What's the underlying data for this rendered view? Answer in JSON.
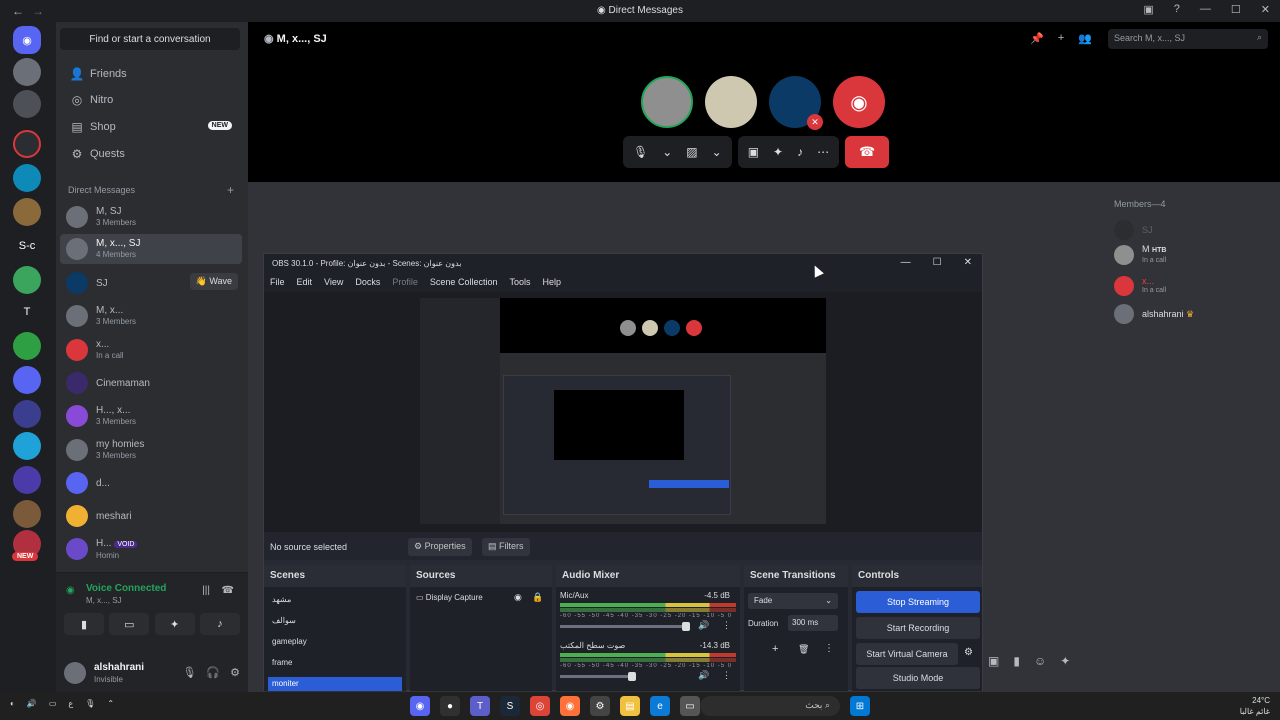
{
  "titlebar": {
    "title": "Direct Messages"
  },
  "sidebar": {
    "search_label": "Find or start a conversation",
    "nav": [
      {
        "label": "Friends",
        "icon": "friends-icon"
      },
      {
        "label": "Nitro",
        "icon": "nitro-icon"
      },
      {
        "label": "Shop",
        "icon": "shop-icon",
        "badge": "NEW"
      },
      {
        "label": "Quests",
        "icon": "quests-icon"
      }
    ],
    "dm_header": "Direct Messages",
    "dms": [
      {
        "name": "M, SJ",
        "sub": "3 Members"
      },
      {
        "name": "M, x..., SJ",
        "sub": "4 Members"
      },
      {
        "name": "SJ",
        "sub": "",
        "action": "Wave"
      },
      {
        "name": "M, x...",
        "sub": "3 Members"
      },
      {
        "name": "x...",
        "sub": "In a call"
      },
      {
        "name": "Cinemaman",
        "sub": ""
      },
      {
        "name": "H..., x...",
        "sub": "3 Members"
      },
      {
        "name": "my homies",
        "sub": "3 Members"
      },
      {
        "name": "d...",
        "sub": ""
      },
      {
        "name": "meshari",
        "sub": ""
      },
      {
        "name": "H...",
        "sub": "Homin",
        "tag": "VOID"
      }
    ],
    "voice": {
      "title": "Voice Connected",
      "sub": "M, x..., SJ"
    },
    "user": {
      "name": "alshahrani",
      "status": "Invisible"
    }
  },
  "rail": {
    "new_badge": "NEW",
    "text_servers": [
      "S-c",
      "T"
    ]
  },
  "call": {
    "header": "M, x..., SJ",
    "search_placeholder": "Search M, x..., SJ",
    "members_header": "Members—4",
    "members": [
      {
        "name": "SJ",
        "sub": ""
      },
      {
        "name": "M",
        "sub": "In a call",
        "tag": "HTB"
      },
      {
        "name": "x...",
        "sub": "In a call"
      },
      {
        "name": "alshahrani",
        "sub": "",
        "crown": "♛"
      }
    ]
  },
  "obs": {
    "title": "OBS 30.1.0 - Profile: بدون عنوان - Scenes: بدون عنوان",
    "menu": [
      "File",
      "Edit",
      "View",
      "Docks",
      "Profile",
      "Scene Collection",
      "Tools",
      "Help"
    ],
    "no_source": "No source selected",
    "properties_label": "Properties",
    "filters_label": "Filters",
    "docks": {
      "scenes": "Scenes",
      "sources": "Sources",
      "mixer": "Audio Mixer",
      "transitions": "Scene Transitions",
      "controls": "Controls"
    },
    "scenes": [
      "مشهد",
      "سوالف",
      "gameplay",
      "frame",
      "moniter"
    ],
    "sources": [
      "Display Capture"
    ],
    "mixer": [
      {
        "name": "Mic/Aux",
        "db": "-4.5 dB"
      },
      {
        "name": "صوت سطح المكتب",
        "db": "-14.3 dB"
      }
    ],
    "mixer_scale": "-60 -55 -50 -45 -40 -35 -30 -25 -20 -15 -10 -5 0",
    "transition": {
      "type": "Fade",
      "duration_label": "Duration",
      "duration": "300 ms"
    },
    "controls": [
      "Stop Streaming",
      "Start Recording",
      "Start Virtual Camera",
      "Studio Mode"
    ]
  },
  "taskbar": {
    "search": "بحث",
    "time": "24°C",
    "weather": "غائم غالبا",
    "left_text": "ع"
  }
}
